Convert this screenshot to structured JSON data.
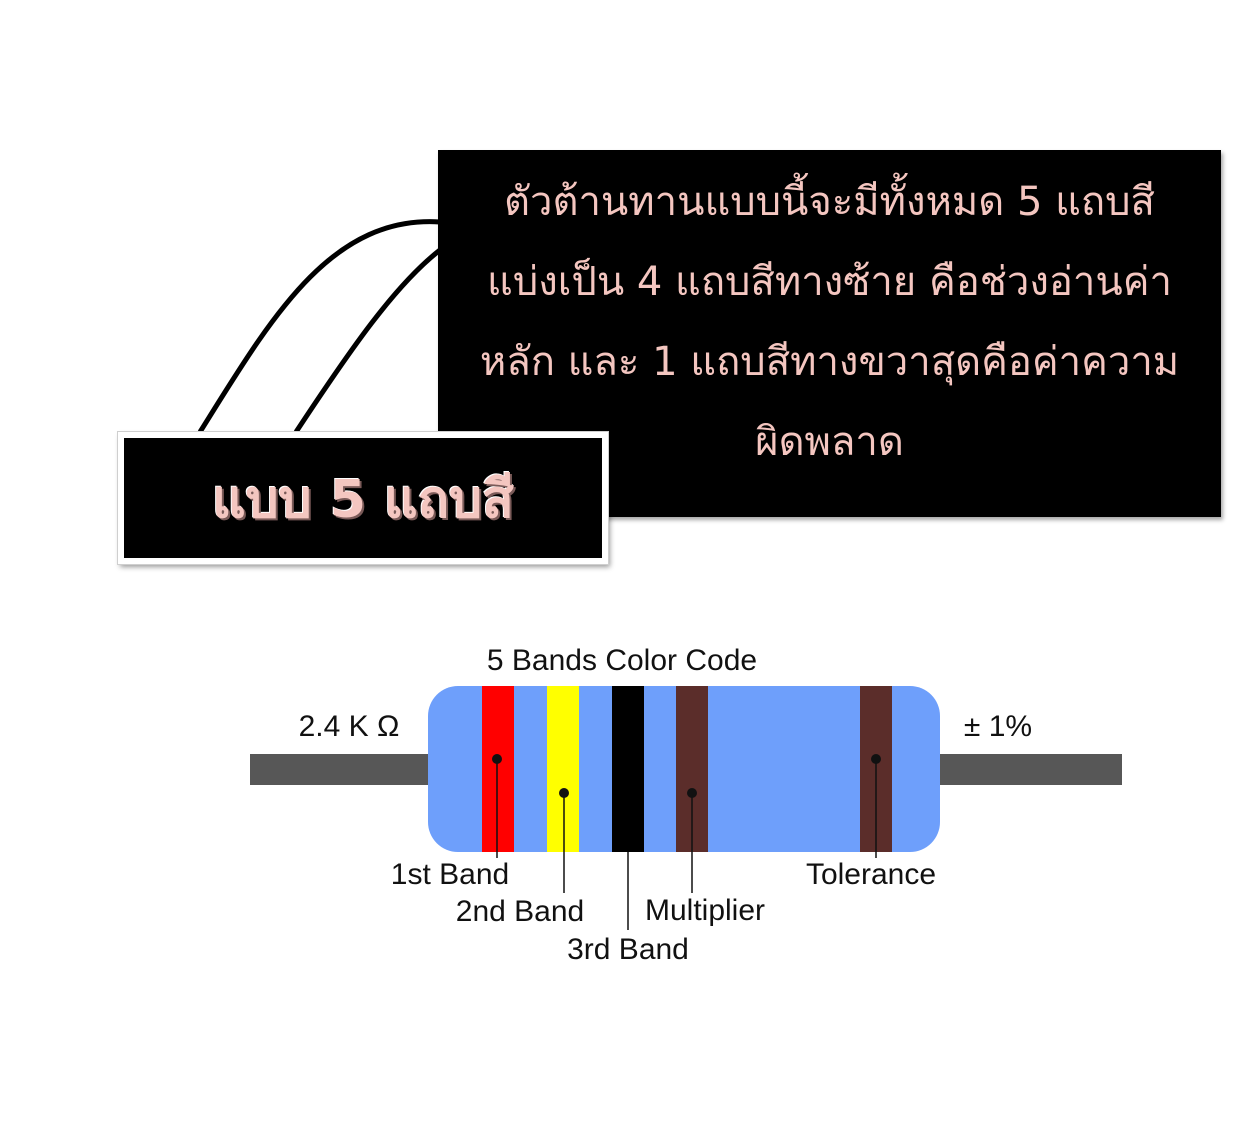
{
  "title_box": {
    "text": "แบบ 5 แถบสี"
  },
  "description": {
    "lines": [
      "ตัวต้านทานแบบนี้จะมีทั้งหมด 5 แถบสี",
      "แบ่งเป็น 4 แถบสีทางซ้าย คือช่วงอ่านค่า",
      "หลัก และ 1 แถบสีทางขวาสุดคือค่าความ",
      "ผิดพลาด"
    ]
  },
  "diagram": {
    "title": "5 Bands Color Code",
    "resistance_value": "2.4 K Ω",
    "tolerance_value": "± 1%",
    "body_color": "#6e9ffb",
    "lead_color": "#575757",
    "bands": [
      {
        "label": "1st Band",
        "color": "#ff0000"
      },
      {
        "label": "2nd Band",
        "color": "#ffff00"
      },
      {
        "label": "3rd Band",
        "color": "#000000"
      },
      {
        "label": "Multiplier",
        "color": "#5b2d2a"
      },
      {
        "label": "Tolerance",
        "color": "#5b2d2a"
      }
    ]
  }
}
